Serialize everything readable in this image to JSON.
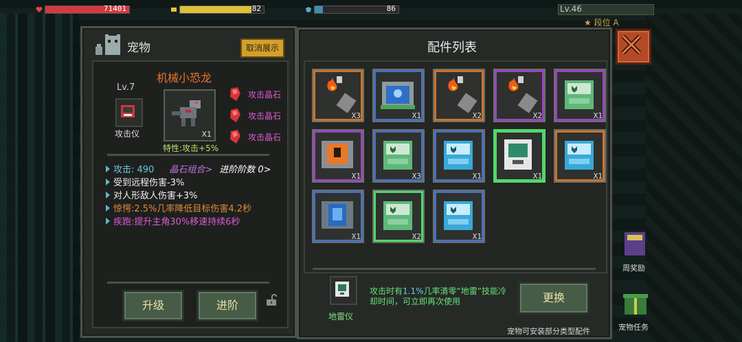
{
  "top": {
    "hp_value": "71401",
    "energy_value": "82",
    "shield_value": "86",
    "player_level": "Lv.46",
    "rank_label": "段位 A"
  },
  "pet_panel": {
    "title": "宠物",
    "cancel_display": "取消展示",
    "pet_name": "机械小恐龙",
    "level": "Lv.7",
    "gear_label": "攻击仪",
    "pet_count": "X1",
    "trait": "特性:攻击+5%",
    "gems": [
      "攻击晶石",
      "攻击晶石",
      "攻击晶石"
    ],
    "stats": {
      "attack": "攻击: 490",
      "gem_combo": "晶石组合>",
      "advance": "进阶阶数 0>",
      "s1": "受到远程伤害-3%",
      "s2": "对人形敌人伤害+3%",
      "s3": "惊愕:2.5%几率降低目标伤害4.2秒",
      "s4": "疾跑:提升主角30%移速持续6秒"
    },
    "upgrade_button": "升级",
    "advance_button": "进阶"
  },
  "parts_panel": {
    "title": "配件列表",
    "items": [
      {
        "icon": "fire-capsule-icon",
        "count": "X3",
        "border": "#c9742d"
      },
      {
        "icon": "blue-monitor-icon",
        "count": "X1",
        "border": "#4a6fbf"
      },
      {
        "icon": "fire-capsule-icon",
        "count": "X2",
        "border": "#c9742d"
      },
      {
        "icon": "fire-capsule-icon",
        "count": "X2",
        "border": "#9a45c2"
      },
      {
        "icon": "green-card-icon",
        "count": "X1",
        "border": "#9a45c2"
      },
      {
        "icon": "orange-scanner-icon",
        "count": "X1",
        "border": "#9a45c2"
      },
      {
        "icon": "green-card-icon",
        "count": "X3",
        "border": "#4a6fbf"
      },
      {
        "icon": "blue-card-icon",
        "count": "X1",
        "border": "#4a6fbf"
      },
      {
        "icon": "white-scanner-icon",
        "count": "X1",
        "border": "#52d86a"
      },
      {
        "icon": "blue-card-icon",
        "count": "X1",
        "border": "#c9742d"
      },
      {
        "icon": "blue-phone-icon",
        "count": "X1",
        "border": "#4a6fbf"
      },
      {
        "icon": "green-card-icon",
        "count": "X2",
        "border": "#52d86a"
      },
      {
        "icon": "blue-card-icon",
        "count": "X1",
        "border": "#4a6fbf"
      }
    ],
    "selected_name": "地雷仪",
    "desc_prefix": "攻击时有",
    "desc_highlight": "1.1%",
    "desc_suffix": "几率清零“地雷”技能冷却时间，可立即再次使用",
    "swap_button": "更换",
    "footnote": "宠物可安装部分类型配件"
  },
  "side": {
    "weekly_reward": "周奖励",
    "pet_task": "宠物任务"
  }
}
